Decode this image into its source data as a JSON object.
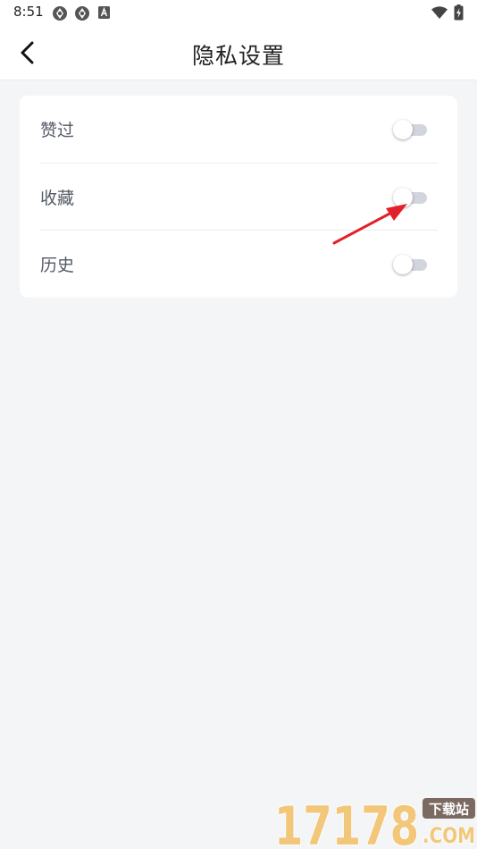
{
  "status_bar": {
    "time": "8:51",
    "icons": [
      "cloud-sync-icon",
      "cloud-sync-icon",
      "keyboard-a-icon",
      "wifi-icon",
      "battery-charging-icon"
    ]
  },
  "header": {
    "title": "隐私设置",
    "back_icon": "chevron-left-icon"
  },
  "settings": [
    {
      "label": "赞过",
      "enabled": false
    },
    {
      "label": "收藏",
      "enabled": false
    },
    {
      "label": "历史",
      "enabled": false
    }
  ],
  "annotation": {
    "arrow_color": "#e3202a"
  },
  "watermark": {
    "number": "17178",
    "badge": "下载站",
    "domain": ".COM",
    "colors": {
      "number": "#f2c77a",
      "badge": "#7a6a62"
    }
  }
}
